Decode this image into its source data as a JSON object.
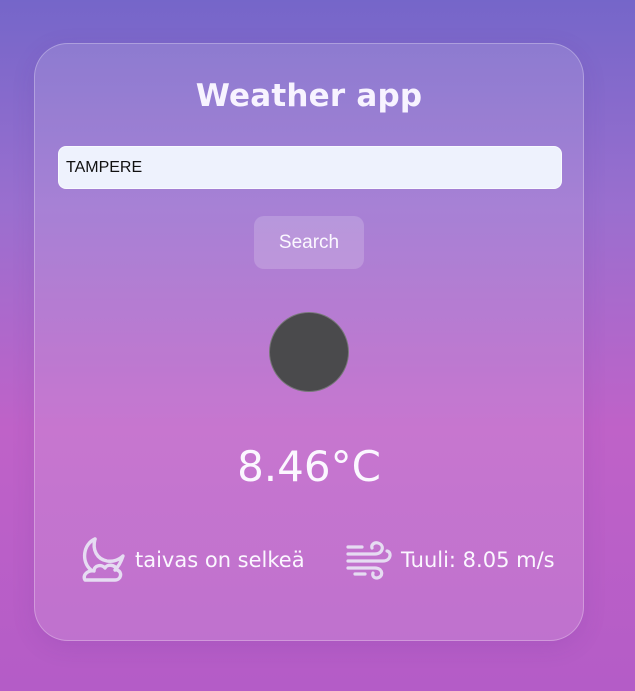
{
  "app": {
    "title": "Weather app"
  },
  "search": {
    "value": "TAMPERE",
    "button_label": "Search"
  },
  "weather": {
    "icon": "weather-icon",
    "temperature": "8.46°C",
    "description": "taivas on selkeä",
    "description_icon": "moon-cloud-icon",
    "wind": "Tuuli: 8.05 m/s",
    "wind_icon": "wind-icon"
  },
  "colors": {
    "background_top": "#7566c9",
    "background_bottom": "#b45cc7",
    "text": "#fbf7ff",
    "input_background": "#eef2fd",
    "weather_icon_fill": "#4a4a4c"
  }
}
